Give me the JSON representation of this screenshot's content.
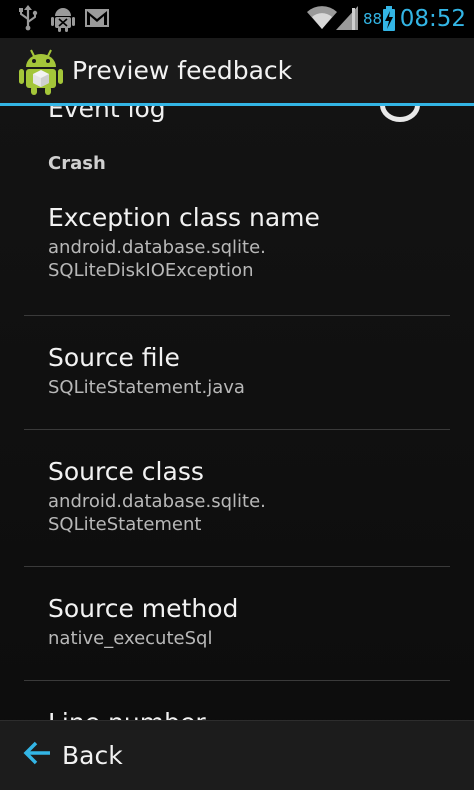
{
  "status_bar": {
    "time": "08:52",
    "battery_level": "88",
    "icons": [
      "usb-icon",
      "android-debug-icon",
      "gmail-icon",
      "wifi-icon",
      "signal-icon",
      "battery-icon"
    ]
  },
  "action_bar": {
    "title": "Preview feedback",
    "app_icon": "android-package-icon"
  },
  "list": {
    "partial_item_title": "Event log",
    "section_header": "Crash",
    "items": [
      {
        "title": "Exception class name",
        "summary": "android.database.sqlite.\nSQLiteDiskIOException"
      },
      {
        "title": "Source file",
        "summary": "SQLiteStatement.java"
      },
      {
        "title": "Source class",
        "summary": "android.database.sqlite.\nSQLiteStatement"
      },
      {
        "title": "Source method",
        "summary": "native_executeSql"
      },
      {
        "title": "Line number",
        "summary": ""
      }
    ]
  },
  "bottom_bar": {
    "back_label": "Back",
    "back_icon": "arrow-left-icon"
  },
  "colors": {
    "accent": "#33b5e5",
    "background": "#111111",
    "primary_text": "#f2f2f2",
    "secondary_text": "#b8b8b8"
  }
}
